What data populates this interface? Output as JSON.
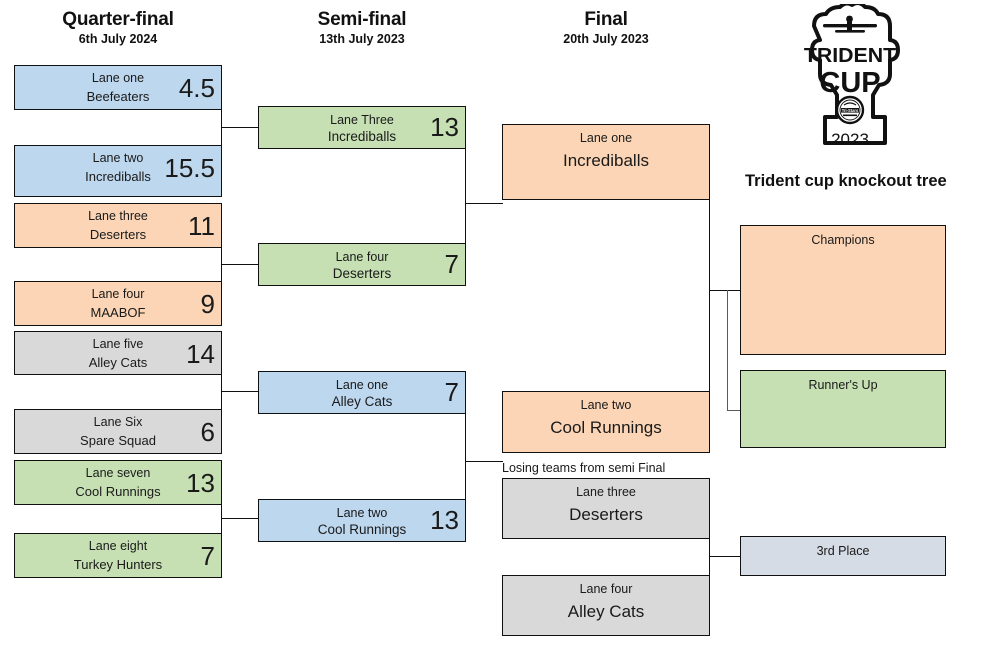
{
  "columns": [
    {
      "title": "Quarter-final",
      "date": "6th July 2024"
    },
    {
      "title": "Semi-final",
      "date": "13th July 2023"
    },
    {
      "title": "Final",
      "date": "20th July 2023"
    }
  ],
  "quarter_final": [
    {
      "lane": "Lane one",
      "team": "Beefeaters",
      "score": "4.5",
      "color": "#bdd7ee"
    },
    {
      "lane": "Lane two",
      "team": "Incrediballs",
      "score": "15.5",
      "color": "#bdd7ee"
    },
    {
      "lane": "Lane three",
      "team": "Deserters",
      "score": "11",
      "color": "#fbd5b5"
    },
    {
      "lane": "Lane four",
      "team": "MAABOF",
      "score": "9",
      "color": "#fbd5b5"
    },
    {
      "lane": "Lane five",
      "team": "Alley Cats",
      "score": "14",
      "color": "#d9d9d9"
    },
    {
      "lane": "Lane Six",
      "team": "Spare Squad",
      "score": "6",
      "color": "#d9d9d9"
    },
    {
      "lane": "Lane seven",
      "team": "Cool Runnings",
      "score": "13",
      "color": "#c6e0b4"
    },
    {
      "lane": "Lane eight",
      "team": "Turkey Hunters",
      "score": "7",
      "color": "#c6e0b4"
    }
  ],
  "semi_final": [
    {
      "lane": "Lane Three",
      "team": "Incrediballs",
      "score": "13",
      "color": "#c6e0b4"
    },
    {
      "lane": "Lane four",
      "team": "Deserters",
      "score": "7",
      "color": "#c6e0b4"
    },
    {
      "lane": "Lane one",
      "team": "Alley Cats",
      "score": "7",
      "color": "#bdd7ee"
    },
    {
      "lane": "Lane two",
      "team": "Cool Runnings",
      "score": "13",
      "color": "#bdd7ee"
    }
  ],
  "final": [
    {
      "lane": "Lane one",
      "team": "Incrediballs",
      "color": "#fbd5b5"
    },
    {
      "lane": "Lane two",
      "team": "Cool Runnings",
      "color": "#fbd5b5"
    }
  ],
  "losers_note": "Losing teams from semi Final",
  "losers": [
    {
      "lane": "Lane three",
      "team": "Deserters",
      "color": "#d9d9d9"
    },
    {
      "lane": "Lane four",
      "team": "Alley Cats",
      "color": "#d9d9d9"
    }
  ],
  "results": [
    {
      "label": "Champions",
      "color": "#fbd5b5"
    },
    {
      "label": "Runner's Up",
      "color": "#c6e0b4"
    },
    {
      "label": "3rd Place",
      "color": "#d6dce5"
    }
  ],
  "logo": {
    "line1": "TRIDENT",
    "line2": "CUP",
    "year": "2023",
    "badge_text": "Tri-Stars"
  },
  "caption": "Trident cup knockout tree",
  "colors": {
    "blue": "#bdd7ee",
    "orange": "#fbd5b5",
    "grey": "#d9d9d9",
    "green": "#c6e0b4",
    "slate": "#d6dce5",
    "line": "#101010",
    "line_grey": "#5a5a5a"
  }
}
